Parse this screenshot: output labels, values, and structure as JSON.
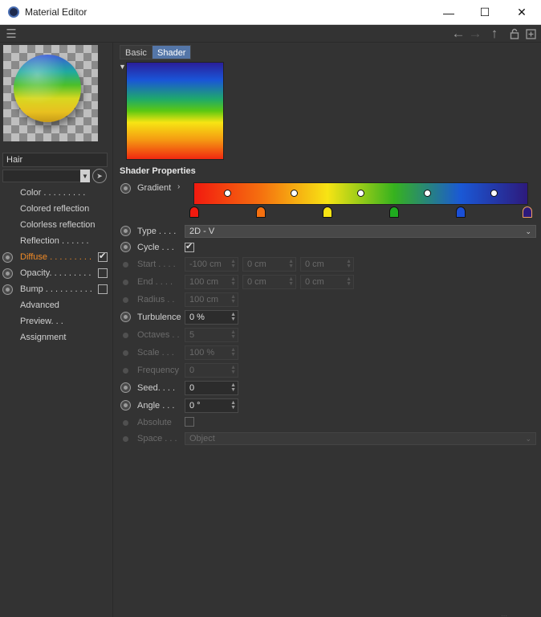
{
  "window": {
    "title": "Material Editor",
    "minimize": "—",
    "maximize": "☐",
    "close": "✕"
  },
  "toolbar": {
    "menu_icon": "hamburger-icon",
    "back_icon": "arrow-left-icon",
    "forward_icon": "arrow-right-icon",
    "up_icon": "arrow-up-icon",
    "lock_icon": "lock-icon",
    "newwin_icon": "new-window-icon"
  },
  "material": {
    "name": "Hair"
  },
  "channels": [
    {
      "label": "Color . . . . . . . . ."
    },
    {
      "label": "Colored reflection"
    },
    {
      "label": "Colorless reflection"
    },
    {
      "label": "Reflection . . . . . ."
    },
    {
      "label": "Diffuse . . . . . . . . .",
      "checked": true
    },
    {
      "label": "Opacity. . . . . . . . .",
      "checked": false
    },
    {
      "label": "Bump . . . . . . . . . .",
      "checked": false
    },
    {
      "label": "Advanced"
    },
    {
      "label": "Preview. . ."
    },
    {
      "label": "Assignment"
    }
  ],
  "tabs": {
    "basic": "Basic",
    "shader": "Shader"
  },
  "section": {
    "title": "Shader Properties"
  },
  "gradient": {
    "label": "Gradient",
    "stop_colors": [
      "#f21a0f",
      "#f5700f",
      "#f7e414",
      "#1faa1f",
      "#1a4fd6",
      "#2d1a7c"
    ],
    "stop_positions": [
      0,
      0.2,
      0.4,
      0.6,
      0.8,
      1.0
    ],
    "knot_positions": [
      0.1,
      0.3,
      0.5,
      0.7,
      0.9
    ]
  },
  "props": {
    "type": {
      "label": "Type . . . .",
      "value": "2D - V"
    },
    "cycle": {
      "label": "Cycle . . .",
      "checked": true
    },
    "start": {
      "label": "Start . . . .",
      "x": "-100 cm",
      "y": "0 cm",
      "z": "0 cm"
    },
    "end": {
      "label": "End . . . .",
      "x": "100 cm",
      "y": "0 cm",
      "z": "0 cm"
    },
    "radius": {
      "label": "Radius . .",
      "value": "100 cm"
    },
    "turbulence": {
      "label": "Turbulence",
      "value": "0 %"
    },
    "octaves": {
      "label": "Octaves . .",
      "value": "5"
    },
    "scale": {
      "label": "Scale . . .",
      "value": "100 %"
    },
    "frequency": {
      "label": "Frequency",
      "value": "0"
    },
    "seed": {
      "label": "Seed. . . .",
      "value": "0"
    },
    "angle": {
      "label": "Angle . . .",
      "value": "0 °"
    },
    "absolute": {
      "label": "Absolute",
      "checked": false
    },
    "space": {
      "label": "Space . . .",
      "value": "Object"
    }
  }
}
